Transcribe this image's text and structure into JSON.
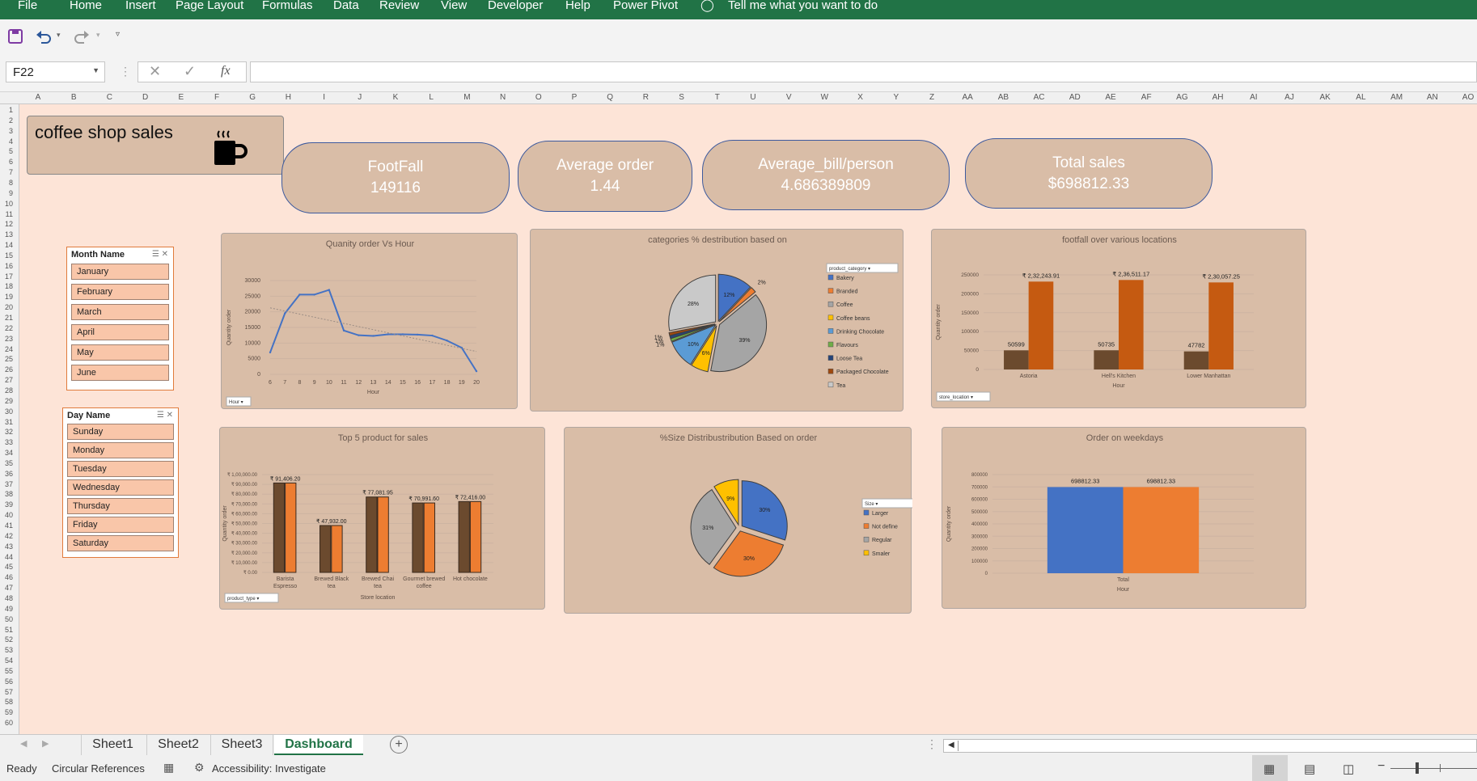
{
  "ribbon": {
    "file": "File",
    "home": "Home",
    "insert": "Insert",
    "page_layout": "Page Layout",
    "formulas": "Formulas",
    "data": "Data",
    "review": "Review",
    "view": "View",
    "developer": "Developer",
    "help": "Help",
    "power_pivot": "Power Pivot",
    "tell_me": "Tell me what you want to do"
  },
  "formula_bar": {
    "name_box": "F22",
    "fx": "fx",
    "formula": ""
  },
  "columns": [
    "A",
    "B",
    "C",
    "D",
    "E",
    "F",
    "G",
    "H",
    "I",
    "J",
    "K",
    "L",
    "M",
    "N",
    "O",
    "P",
    "Q",
    "R",
    "S",
    "T",
    "U",
    "V",
    "W",
    "X",
    "Y",
    "Z",
    "AA",
    "AB",
    "AC",
    "AD",
    "AE",
    "AF",
    "AG",
    "AH",
    "AI",
    "AJ",
    "AK",
    "AL",
    "AM",
    "AN",
    "AO"
  ],
  "row_count": 60,
  "dashboard": {
    "title": "coffee shop sales",
    "cup_icon": "coffee-cup-icon",
    "kpis": [
      {
        "label": "FootFall",
        "value": "149116"
      },
      {
        "label": "Average order",
        "value": "1.44"
      },
      {
        "label": "Average_bill/person",
        "value": "4.686389809"
      },
      {
        "label": "Total sales",
        "value": "$698812.33"
      }
    ],
    "slicer_month": {
      "title": "Month Name",
      "items": [
        "January",
        "February",
        "March",
        "April",
        "May",
        "June"
      ]
    },
    "slicer_day": {
      "title": "Day Name",
      "items": [
        "Sunday",
        "Monday",
        "Tuesday",
        "Wednesday",
        "Thursday",
        "Friday",
        "Saturday"
      ]
    }
  },
  "chart_data": [
    {
      "type": "line",
      "title": "Quanity order Vs Hour",
      "xlabel": "Hour",
      "ylabel": "Quantity order",
      "x": [
        6,
        7,
        8,
        9,
        10,
        11,
        12,
        13,
        14,
        15,
        16,
        17,
        18,
        19,
        20
      ],
      "values": [
        7000,
        19500,
        25500,
        25500,
        27000,
        14000,
        12500,
        12300,
        12800,
        12800,
        12700,
        12400,
        10800,
        8500,
        1000
      ],
      "trendline": true,
      "ylim": [
        0,
        30000
      ],
      "yticks": [
        "0",
        "5000",
        "10000",
        "15000",
        "20000",
        "25000",
        "30000"
      ],
      "filter_button": "Hour",
      "colors": {
        "line": "#4472c4",
        "trend": "#9a8c84"
      }
    },
    {
      "type": "pie",
      "title": "categories % destribution based on",
      "legend_title": "product_category",
      "slices": [
        {
          "name": "Bakery",
          "value": 12,
          "label": "12%",
          "color": "#4472c4"
        },
        {
          "name": "Branded",
          "value": 2,
          "label": "2%",
          "color": "#ed7d31"
        },
        {
          "name": "Coffee",
          "value": 39,
          "label": "39%",
          "color": "#a5a5a5"
        },
        {
          "name": "Coffee beans",
          "value": 6,
          "label": "6%",
          "color": "#ffc000"
        },
        {
          "name": "Drinking Chocolate",
          "value": 10,
          "label": "10%",
          "color": "#5b9bd5"
        },
        {
          "name": "Flavours",
          "value": 1,
          "label": "1%",
          "color": "#70ad47"
        },
        {
          "name": "Loose Tea",
          "value": 1,
          "label": "1%",
          "color": "#264478"
        },
        {
          "name": "Packaged Chocolate",
          "value": 1,
          "label": "1%",
          "color": "#9e480e"
        },
        {
          "name": "Tea",
          "value": 28,
          "label": "28%",
          "color": "#c9c9c9"
        }
      ],
      "legend_position": "right"
    },
    {
      "type": "bar",
      "title": "footfall over various locations",
      "xlabel": "Hour",
      "ylabel": "Quantity order",
      "categories": [
        "Astoria",
        "Hell's Kitchen",
        "Lower Manhattan"
      ],
      "series": [
        {
          "values": [
            50599,
            50735,
            47782
          ],
          "labels": [
            "50599",
            "50735",
            "47782"
          ],
          "color": "#6b4a2e"
        },
        {
          "values": [
            232243.91,
            236511.17,
            230057.25
          ],
          "labels": [
            "₹ 2,32,243.91",
            "₹ 2,36,511.17",
            "₹ 2,30,057.25"
          ],
          "color": "#c55a11"
        }
      ],
      "ylim": [
        0,
        250000
      ],
      "yticks": [
        "0",
        "50000",
        "100000",
        "150000",
        "200000",
        "250000"
      ],
      "filter_button": "store_location"
    },
    {
      "type": "bar",
      "title": "Top 5 product for sales",
      "xlabel": "Store location",
      "ylabel": "Quantity order",
      "categories": [
        "Barista Espresso",
        "Brewed Black tea",
        "Brewed Chai tea",
        "Gourmet brewed coffee",
        "Hot chocolate"
      ],
      "series": [
        {
          "values": [
            91406,
            47932,
            77081,
            70991,
            72416
          ],
          "color": "#6b4a2e"
        },
        {
          "values": [
            91406.2,
            47932,
            77081.95,
            70991.6,
            72416
          ],
          "color": "#ed7d31"
        }
      ],
      "data_labels": [
        "₹ 91,406.20",
        "₹ 47,932.00",
        "₹ 77,081.95",
        "₹ 70,991.60",
        "₹ 72,416.00"
      ],
      "ylim": [
        0,
        100000
      ],
      "yticks": [
        "₹ 0.00",
        "₹ 10,000.00",
        "₹ 20,000.00",
        "₹ 30,000.00",
        "₹ 40,000.00",
        "₹ 50,000.00",
        "₹ 60,000.00",
        "₹ 70,000.00",
        "₹ 80,000.00",
        "₹ 90,000.00",
        "₹ 1,00,000.00"
      ],
      "filter_button": "product_type"
    },
    {
      "type": "pie",
      "title": "%Size Distribustribution Based on order",
      "legend_title": "Size",
      "slices": [
        {
          "name": "Larger",
          "value": 30,
          "label": "30%",
          "color": "#4472c4"
        },
        {
          "name": "Not define",
          "value": 30,
          "label": "30%",
          "color": "#ed7d31"
        },
        {
          "name": "Regular",
          "value": 31,
          "label": "31%",
          "color": "#a5a5a5"
        },
        {
          "name": "Smaler",
          "value": 9,
          "label": "9%",
          "color": "#ffc000"
        }
      ],
      "legend_position": "right"
    },
    {
      "type": "bar",
      "title": "Order on weekdays",
      "xlabel": "Hour",
      "ylabel": "Quantity order",
      "categories": [
        "Total"
      ],
      "series": [
        {
          "values": [
            698812.33
          ],
          "labels": [
            "698812.33"
          ],
          "color": "#4472c4"
        },
        {
          "values": [
            698812.33
          ],
          "labels": [
            "698812.33"
          ],
          "color": "#ed7d31"
        }
      ],
      "ylim": [
        0,
        800000
      ],
      "yticks": [
        "0",
        "100000",
        "200000",
        "300000",
        "400000",
        "500000",
        "600000",
        "700000",
        "800000"
      ]
    }
  ],
  "tabs": [
    "Sheet1",
    "Sheet2",
    "Sheet3",
    "Dashboard"
  ],
  "active_tab": "Dashboard",
  "status": {
    "ready": "Ready",
    "circular": "Circular References",
    "accessibility": "Accessibility: Investigate"
  }
}
